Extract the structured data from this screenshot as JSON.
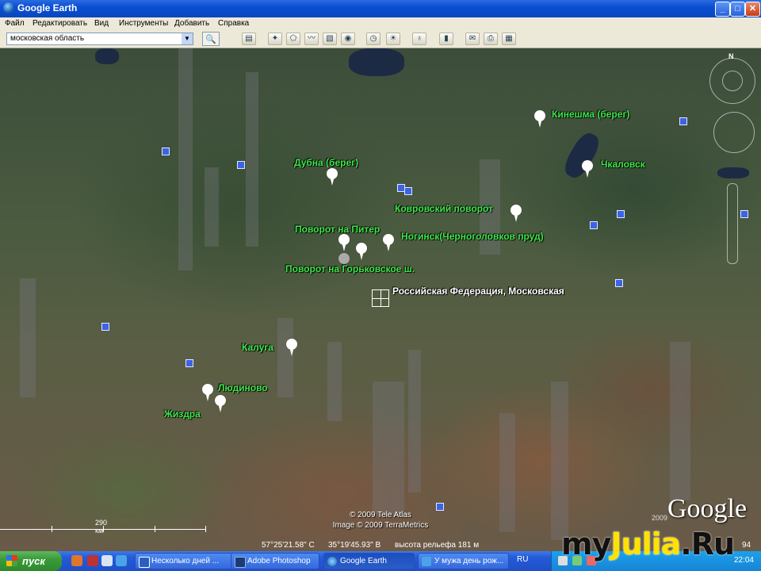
{
  "window": {
    "title": "Google Earth",
    "min": "_",
    "max": "□",
    "close": "✕"
  },
  "menu": [
    "Файл",
    "Редактировать",
    "Вид",
    "Инструменты",
    "Добавить",
    "Справка"
  ],
  "search": {
    "value": "московская область"
  },
  "icons": [
    "search-icon",
    "sidebar-icon",
    "placemark-icon",
    "polygon-icon",
    "path-icon",
    "overlay-icon",
    "tour-icon",
    "history-icon",
    "sunlight-icon",
    "planets-icon",
    "ruler-icon",
    "email-icon",
    "print-icon",
    "map-icon"
  ],
  "map": {
    "labels": [
      {
        "text": "Кинешма (берег)"
      },
      {
        "text": "Чкаловск"
      },
      {
        "text": "Дубна (берег)"
      },
      {
        "text": "Ковровский поворот"
      },
      {
        "text": "Поворот на Питер"
      },
      {
        "text": "Ногинск(Черноголовков пруд)"
      },
      {
        "text": "Поворот на Горьковское ш."
      },
      {
        "text": "Российская Федерация, Московская"
      },
      {
        "text": "Калуга"
      },
      {
        "text": "Людиново"
      },
      {
        "text": "Жиздра"
      }
    ],
    "nav_north": "N",
    "copyright_1": "© 2009 Tele Atlas",
    "copyright_2": "Image © 2009 TerraMetrics",
    "scale": "290 км",
    "logo": "Google",
    "logo_year": "2009"
  },
  "status": {
    "lat": "57°25'21.58\" С",
    "lon": "35°19'45.93\" В",
    "elev": "высота рельефа  181 м",
    "eye": "94"
  },
  "taskbar": {
    "start": "пуск",
    "tasks": [
      {
        "label": "Несколько дней ..."
      },
      {
        "label": "Adobe Photoshop"
      },
      {
        "label": "Google Earth"
      },
      {
        "label": "У мужа день рож..."
      }
    ],
    "lang": "RU",
    "time": "22:04"
  },
  "watermark": {
    "text1": "my",
    "text2": "Julia",
    "text3": ".Ru"
  }
}
